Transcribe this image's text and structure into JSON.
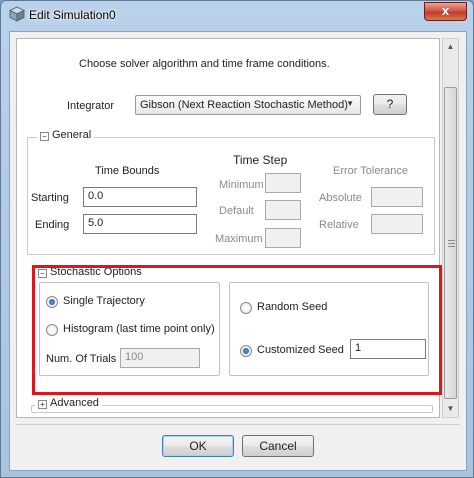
{
  "window": {
    "title": "Edit Simulation0",
    "close_label": "x"
  },
  "intro_text": "Choose solver algorithm and time frame conditions.",
  "integrator": {
    "label": "Integrator",
    "selected": "Gibson (Next Reaction Stochastic Method)",
    "more_button_label": "?"
  },
  "general": {
    "legend": "General",
    "time_bounds": {
      "title": "Time Bounds",
      "starting_label": "Starting",
      "starting_value": "0.0",
      "ending_label": "Ending",
      "ending_value": "5.0"
    },
    "time_step": {
      "title": "Time Step",
      "minimum_label": "Minimum",
      "minimum_value": "",
      "default_label": "Default",
      "default_value": "",
      "maximum_label": "Maximum",
      "maximum_value": ""
    },
    "error_tolerance": {
      "title": "Error Tolerance",
      "absolute_label": "Absolute",
      "absolute_value": "",
      "relative_label": "Relative",
      "relative_value": ""
    }
  },
  "stochastic": {
    "legend": "Stochastic Options",
    "single_trajectory": "Single Trajectory",
    "histogram": "Histogram (last time point only)",
    "num_trials_label": "Num. Of Trials",
    "num_trials_value": "100",
    "random_seed": "Random Seed",
    "customized_seed": "Customized Seed",
    "seed_value": "1",
    "trajectory_mode": "single",
    "seed_mode": "customized"
  },
  "advanced": {
    "legend": "Advanced"
  },
  "buttons": {
    "ok": "OK",
    "cancel": "Cancel"
  },
  "colors": {
    "highlight": "#e0151b",
    "title_bg": "#b9d1ea",
    "close_red": "#c0392b"
  }
}
